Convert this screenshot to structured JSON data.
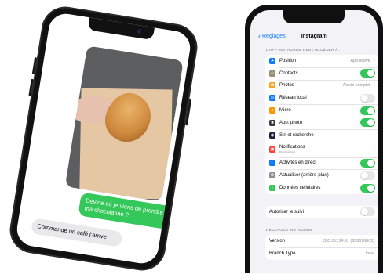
{
  "left_phone": {
    "messages": {
      "sent": "Devine où je viens de prendre ma chocolatine ?",
      "received": "Commande un café j'arrive"
    }
  },
  "right_phone": {
    "nav": {
      "back_label": "Réglages",
      "title": "Instagram"
    },
    "access_header": "L'APP INSTAGRAM PEUT ACCÉDER À :",
    "access_items": [
      {
        "label": "Position",
        "value": "App active",
        "control": "chevron",
        "icon": "location-icon",
        "color": "#0a7aff"
      },
      {
        "label": "Contacts",
        "control": "toggle",
        "on": true,
        "icon": "contacts-icon",
        "color": "#9e8b74"
      },
      {
        "label": "Photos",
        "value": "Accès complet",
        "control": "chevron",
        "icon": "photos-icon",
        "color": "#f5a623"
      },
      {
        "label": "Réseau local",
        "control": "toggle",
        "on": false,
        "icon": "network-icon",
        "color": "#0a7aff"
      },
      {
        "label": "Micro",
        "control": "toggle",
        "on": true,
        "icon": "microphone-icon",
        "color": "#ff9500"
      },
      {
        "label": "App. photo",
        "control": "toggle",
        "on": true,
        "icon": "camera-icon",
        "color": "#3a3a3c"
      },
      {
        "label": "Siri et recherche",
        "control": "chevron",
        "icon": "siri-icon",
        "color": "#1c1c3c"
      },
      {
        "label": "Notifications",
        "sublabel": "Bannières",
        "control": "chevron",
        "icon": "notifications-icon",
        "color": "#ff3b30"
      },
      {
        "label": "Activités en direct",
        "control": "toggle",
        "on": true,
        "icon": "live-activities-icon",
        "color": "#0a7aff"
      },
      {
        "label": "Actualiser (arrière-plan)",
        "control": "toggle",
        "on": false,
        "icon": "background-refresh-icon",
        "color": "#8e8e93"
      },
      {
        "label": "Données cellulaires",
        "control": "toggle",
        "on": true,
        "icon": "cellular-icon",
        "color": "#34c759"
      }
    ],
    "tracking": {
      "label": "Autoriser le suivi",
      "on": false
    },
    "instagram_settings_header": "RÉGLAGES INSTAGRAM",
    "instagram_settings": [
      {
        "label": "Version",
        "value": "355.0.0.34.91 (656616803)"
      },
      {
        "label": "Branch Type",
        "value": "local"
      }
    ]
  }
}
